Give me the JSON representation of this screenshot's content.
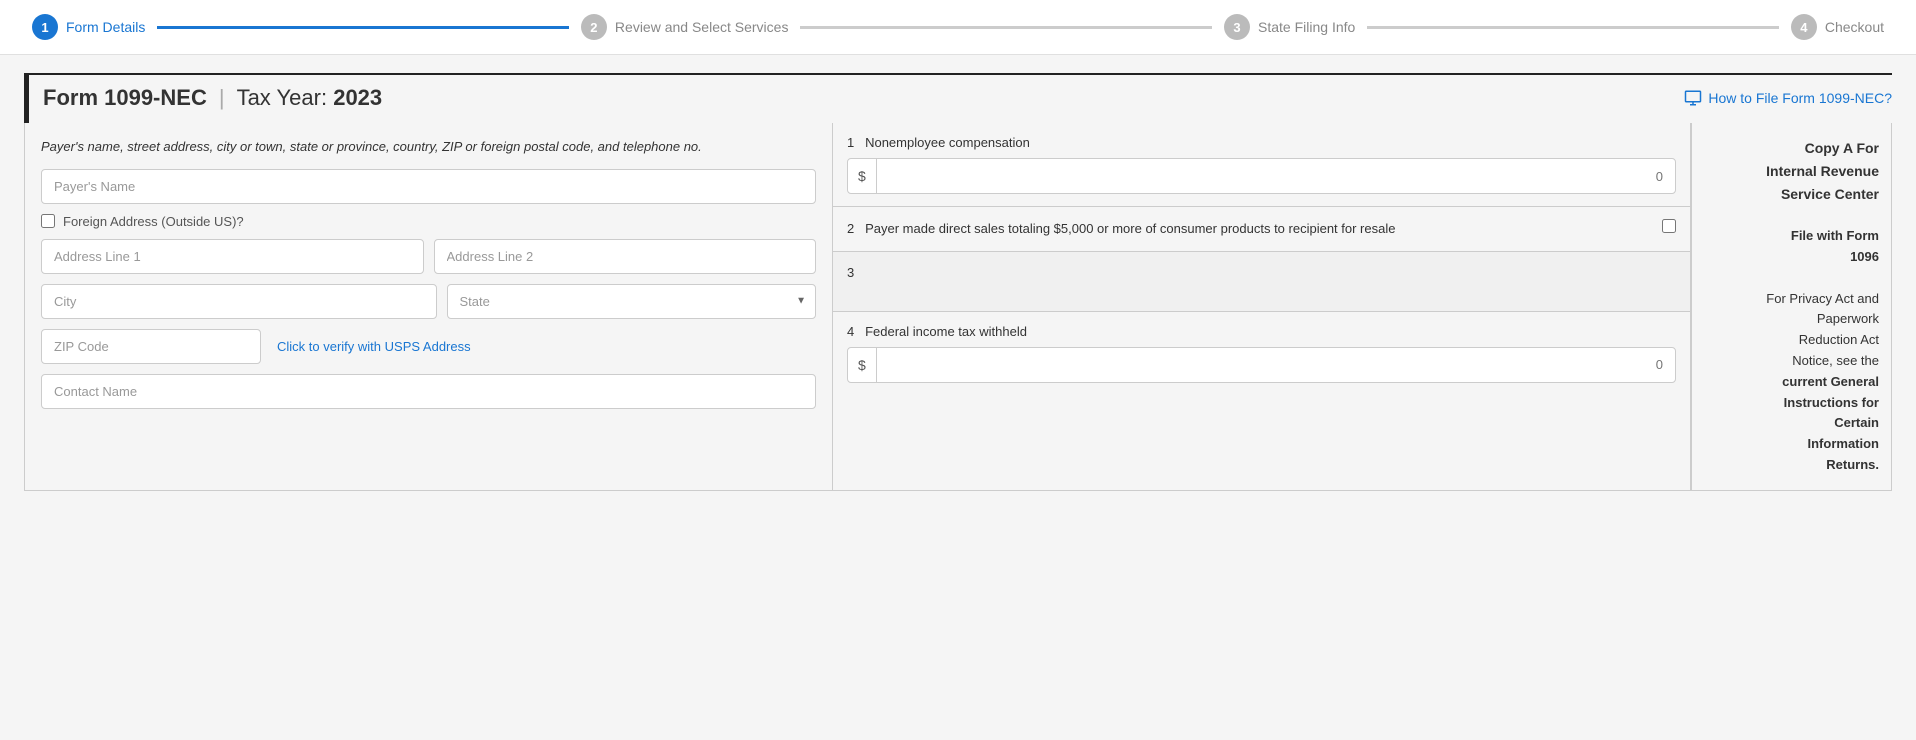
{
  "stepper": {
    "steps": [
      {
        "number": "1",
        "label": "Form Details",
        "status": "active"
      },
      {
        "number": "2",
        "label": "Review and Select Services",
        "status": "inactive"
      },
      {
        "number": "3",
        "label": "State Filing Info",
        "status": "inactive"
      },
      {
        "number": "4",
        "label": "Checkout",
        "status": "inactive"
      }
    ],
    "lines": [
      "active",
      "inactive",
      "inactive"
    ]
  },
  "form": {
    "title": "Form 1099-NEC",
    "separator": "|",
    "tax_year_label": "Tax Year:",
    "tax_year_value": "2023",
    "how_to_link": "How to File Form 1099-NEC?"
  },
  "left_panel": {
    "payer_description": "Payer's name, street address, city or town, state or province, country, ZIP or foreign postal code, and telephone no.",
    "payer_name_placeholder": "Payer's Name",
    "payer_name_required": "*",
    "foreign_address_label": "Foreign Address (Outside US)?",
    "address_line1_placeholder": "Address Line 1",
    "address_line1_required": "*",
    "address_line2_placeholder": "Address Line 2",
    "city_placeholder": "City",
    "city_required": "*",
    "state_placeholder": "State",
    "state_required": "*",
    "zip_placeholder": "ZIP Code",
    "zip_required": "*",
    "usps_link": "Click to verify with USPS Address",
    "contact_name_placeholder": "Contact Name"
  },
  "right_panel": {
    "section1": {
      "number": "1",
      "label": "Nonemployee compensation",
      "placeholder_value": "0"
    },
    "section2": {
      "number": "2",
      "label": "Payer made direct sales totaling $5,000 or more of consumer products to recipient for resale"
    },
    "section3": {
      "number": "3",
      "label": ""
    },
    "section4": {
      "number": "4",
      "label": "Federal income tax withheld",
      "placeholder_value": "0"
    }
  },
  "info_panel": {
    "line1": "Copy A For",
    "line2": "Internal Revenue",
    "line3": "Service Center",
    "line4": "",
    "line5": "File with Form",
    "line6": "1096",
    "line7": "",
    "line8": "For Privacy Act and",
    "line9": "Paperwork",
    "line10": "Reduction Act",
    "line11": "Notice, see the",
    "line12": "current General",
    "line13": "Instructions for",
    "line14": "Certain",
    "line15": "Information",
    "line16": "Returns."
  }
}
